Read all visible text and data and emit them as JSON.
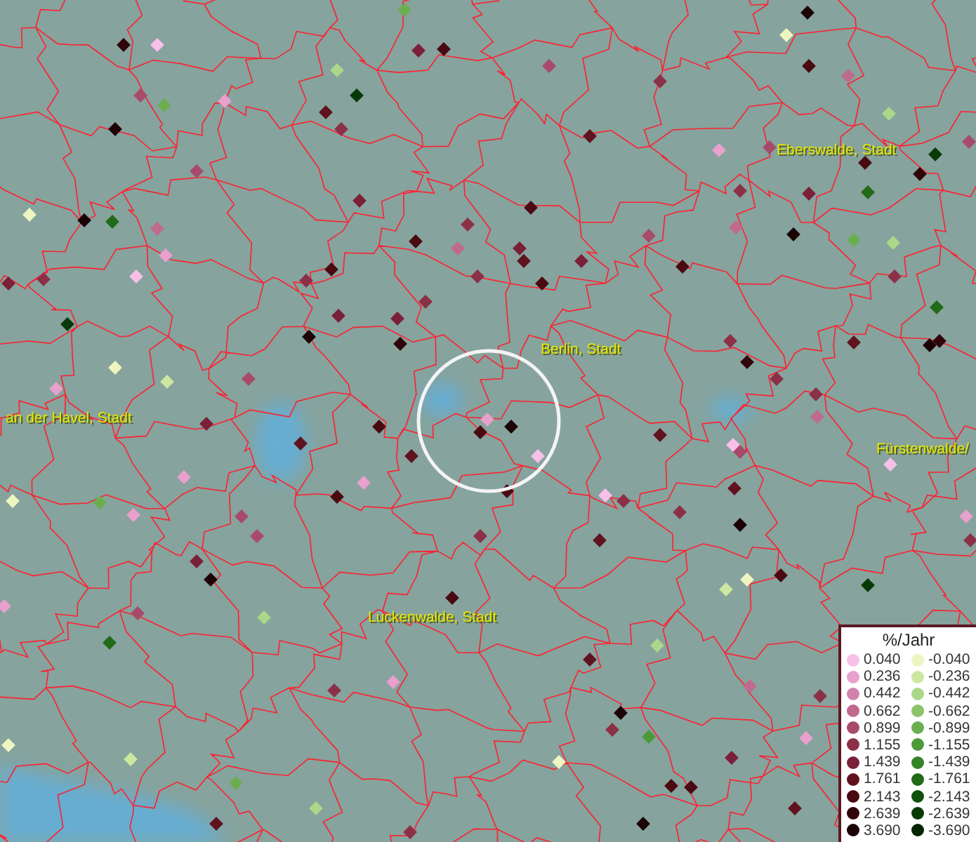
{
  "map": {
    "labels": [
      {
        "text": "Eberswalde, Stadt"
      },
      {
        "text": "Berlin, Stadt"
      },
      {
        "text": "an der Havel, Stadt"
      },
      {
        "text": "Fürstenwalde/"
      },
      {
        "text": "Luckenwalde, Stadt"
      }
    ],
    "markers": [
      {
        "color": "#30050a"
      },
      {
        "color": "#f7c0e8"
      },
      {
        "color": "#60121f"
      },
      {
        "color": "#8c3048"
      },
      {
        "color": "#083a08"
      },
      {
        "color": "#e8a0cc"
      },
      {
        "color": "#a84a6a"
      },
      {
        "color": "#6aae50"
      },
      {
        "color": "#1a0205"
      },
      {
        "color": "#a84a6a"
      },
      {
        "color": "#eef5c0"
      },
      {
        "color": "#1a0205"
      },
      {
        "color": "#206a18"
      },
      {
        "color": "#c06a8e"
      },
      {
        "color": "#e8a0cc"
      },
      {
        "color": "#f7c0e8"
      },
      {
        "color": "#8c3048"
      },
      {
        "color": "#083a08"
      },
      {
        "color": "#7a2038"
      },
      {
        "color": "#7a2038"
      },
      {
        "color": "#8c3048"
      },
      {
        "color": "#4a0a12"
      },
      {
        "color": "#c06a8e"
      },
      {
        "color": "#7a2038"
      },
      {
        "color": "#60121f"
      },
      {
        "color": "#4a0a12"
      },
      {
        "color": "#7a2038"
      },
      {
        "color": "#8c3048"
      },
      {
        "color": "#8c3048"
      },
      {
        "color": "#7a2038"
      },
      {
        "color": "#30050a"
      },
      {
        "color": "#1a0205"
      },
      {
        "color": "#7a2038"
      },
      {
        "color": "#eef5c0"
      },
      {
        "color": "#cce8a0"
      },
      {
        "color": "#e8a0cc"
      },
      {
        "color": "#a84a6a"
      },
      {
        "color": "#7a2038"
      },
      {
        "color": "#4a0a12"
      },
      {
        "color": "#e8a0cc"
      },
      {
        "color": "#4a0a12"
      },
      {
        "color": "#1a0205"
      },
      {
        "color": "#f7c0e8"
      },
      {
        "color": "#4a0a12"
      },
      {
        "color": "#60121f"
      },
      {
        "color": "#60121f"
      },
      {
        "color": "#4a0a12"
      },
      {
        "color": "#e8a0cc"
      },
      {
        "color": "#e8a0cc"
      },
      {
        "color": "#6aae50"
      },
      {
        "color": "#eef5c0"
      },
      {
        "color": "#e8a0cc"
      },
      {
        "color": "#a84a6a"
      },
      {
        "color": "#a84a6a"
      },
      {
        "color": "#1a0205"
      },
      {
        "color": "#7a2038"
      },
      {
        "color": "#a84a6a"
      },
      {
        "color": "#aad888"
      },
      {
        "color": "#206a18"
      },
      {
        "color": "#e8a0cc"
      },
      {
        "color": "#8c3048"
      },
      {
        "color": "#4a0a12"
      },
      {
        "color": "#60121f"
      },
      {
        "color": "#8c3048"
      },
      {
        "color": "#f7c0e8"
      },
      {
        "color": "#60121f"
      },
      {
        "color": "#8c3048"
      },
      {
        "color": "#f7c0e8"
      },
      {
        "color": "#a84a6a"
      },
      {
        "color": "#60121f"
      },
      {
        "color": "#1a0205"
      },
      {
        "color": "#30050a"
      },
      {
        "color": "#8c3048"
      },
      {
        "color": "#8c3048"
      },
      {
        "color": "#8c3048"
      },
      {
        "color": "#c06a8e"
      },
      {
        "color": "#f7c0e8"
      },
      {
        "color": "#4a0a12"
      },
      {
        "color": "#eef5c0"
      },
      {
        "color": "#cce8a0"
      },
      {
        "color": "#083a08"
      },
      {
        "color": "#aad888"
      },
      {
        "color": "#8c3048"
      },
      {
        "color": "#e8a0cc"
      },
      {
        "color": "#60121f"
      },
      {
        "color": "#1a0205"
      },
      {
        "color": "#30050a"
      },
      {
        "color": "#206a18"
      },
      {
        "color": "#8c3048"
      },
      {
        "color": "#6aae50"
      },
      {
        "color": "#aad888"
      },
      {
        "color": "#1a0205"
      },
      {
        "color": "#a84a6a"
      },
      {
        "color": "#e8a0cc"
      },
      {
        "color": "#c06a8e"
      },
      {
        "color": "#8c3048"
      },
      {
        "color": "#7a2038"
      },
      {
        "color": "#206a18"
      },
      {
        "color": "#4a0a12"
      },
      {
        "color": "#30050a"
      },
      {
        "color": "#083a08"
      },
      {
        "color": "#a84a6a"
      },
      {
        "color": "#aad888"
      },
      {
        "color": "#c06a8e"
      },
      {
        "color": "#4a0a12"
      },
      {
        "color": "#eef5c0"
      },
      {
        "color": "#1a0205"
      },
      {
        "color": "#4a0a12"
      },
      {
        "color": "#a84a6a"
      },
      {
        "color": "#8c3048"
      },
      {
        "color": "#a84a6a"
      },
      {
        "color": "#4a0a12"
      },
      {
        "color": "#7a2038"
      },
      {
        "color": "#6aae50"
      },
      {
        "color": "#aad888"
      },
      {
        "color": "#60121f"
      },
      {
        "color": "#4a0a12"
      },
      {
        "color": "#4a0a12"
      },
      {
        "color": "#8c3048"
      },
      {
        "color": "#e8a0cc"
      },
      {
        "color": "#8c3048"
      },
      {
        "color": "#1a0205"
      },
      {
        "color": "#8c3048"
      },
      {
        "color": "#4c9a3a"
      },
      {
        "color": "#eef5c0"
      },
      {
        "color": "#cce8a0"
      },
      {
        "color": "#eef5c0"
      },
      {
        "color": "#6aae50"
      },
      {
        "color": "#aad888"
      },
      {
        "color": "#60121f"
      },
      {
        "color": "#8c3048"
      },
      {
        "color": "#1a0205"
      },
      {
        "color": "#e8a0cc"
      },
      {
        "color": "#60121f"
      },
      {
        "color": "#8c3048"
      },
      {
        "color": "#c06a8e"
      },
      {
        "color": "#7a2038"
      },
      {
        "color": "#4a0a12"
      },
      {
        "color": "#4a0a12"
      },
      {
        "color": "#60121f"
      }
    ]
  },
  "legend": {
    "title": "%/Jahr",
    "entries": [
      {
        "label": "0.040",
        "color": "#f7c0e8"
      },
      {
        "label": "-0.040",
        "color": "#eef5c0"
      },
      {
        "label": "0.236",
        "color": "#e8a0cc"
      },
      {
        "label": "-0.236",
        "color": "#cce8a0"
      },
      {
        "label": "0.442",
        "color": "#d283ad"
      },
      {
        "label": "-0.442",
        "color": "#aad888"
      },
      {
        "label": "0.662",
        "color": "#c06a8e"
      },
      {
        "label": "-0.662",
        "color": "#8cc46a"
      },
      {
        "label": "0.899",
        "color": "#a84a6a"
      },
      {
        "label": "-0.899",
        "color": "#6aae50"
      },
      {
        "label": "1.155",
        "color": "#8c3048"
      },
      {
        "label": "-1.155",
        "color": "#4c9a3a"
      },
      {
        "label": "1.439",
        "color": "#7a2038"
      },
      {
        "label": "-1.439",
        "color": "#348428"
      },
      {
        "label": "1.761",
        "color": "#60121f"
      },
      {
        "label": "-1.761",
        "color": "#206a18"
      },
      {
        "label": "2.143",
        "color": "#4a0a12"
      },
      {
        "label": "-2.143",
        "color": "#10520c"
      },
      {
        "label": "2.639",
        "color": "#30050a"
      },
      {
        "label": "-2.639",
        "color": "#083a08"
      },
      {
        "label": "3.690",
        "color": "#1a0205"
      },
      {
        "label": "-3.690",
        "color": "#042404"
      }
    ]
  }
}
